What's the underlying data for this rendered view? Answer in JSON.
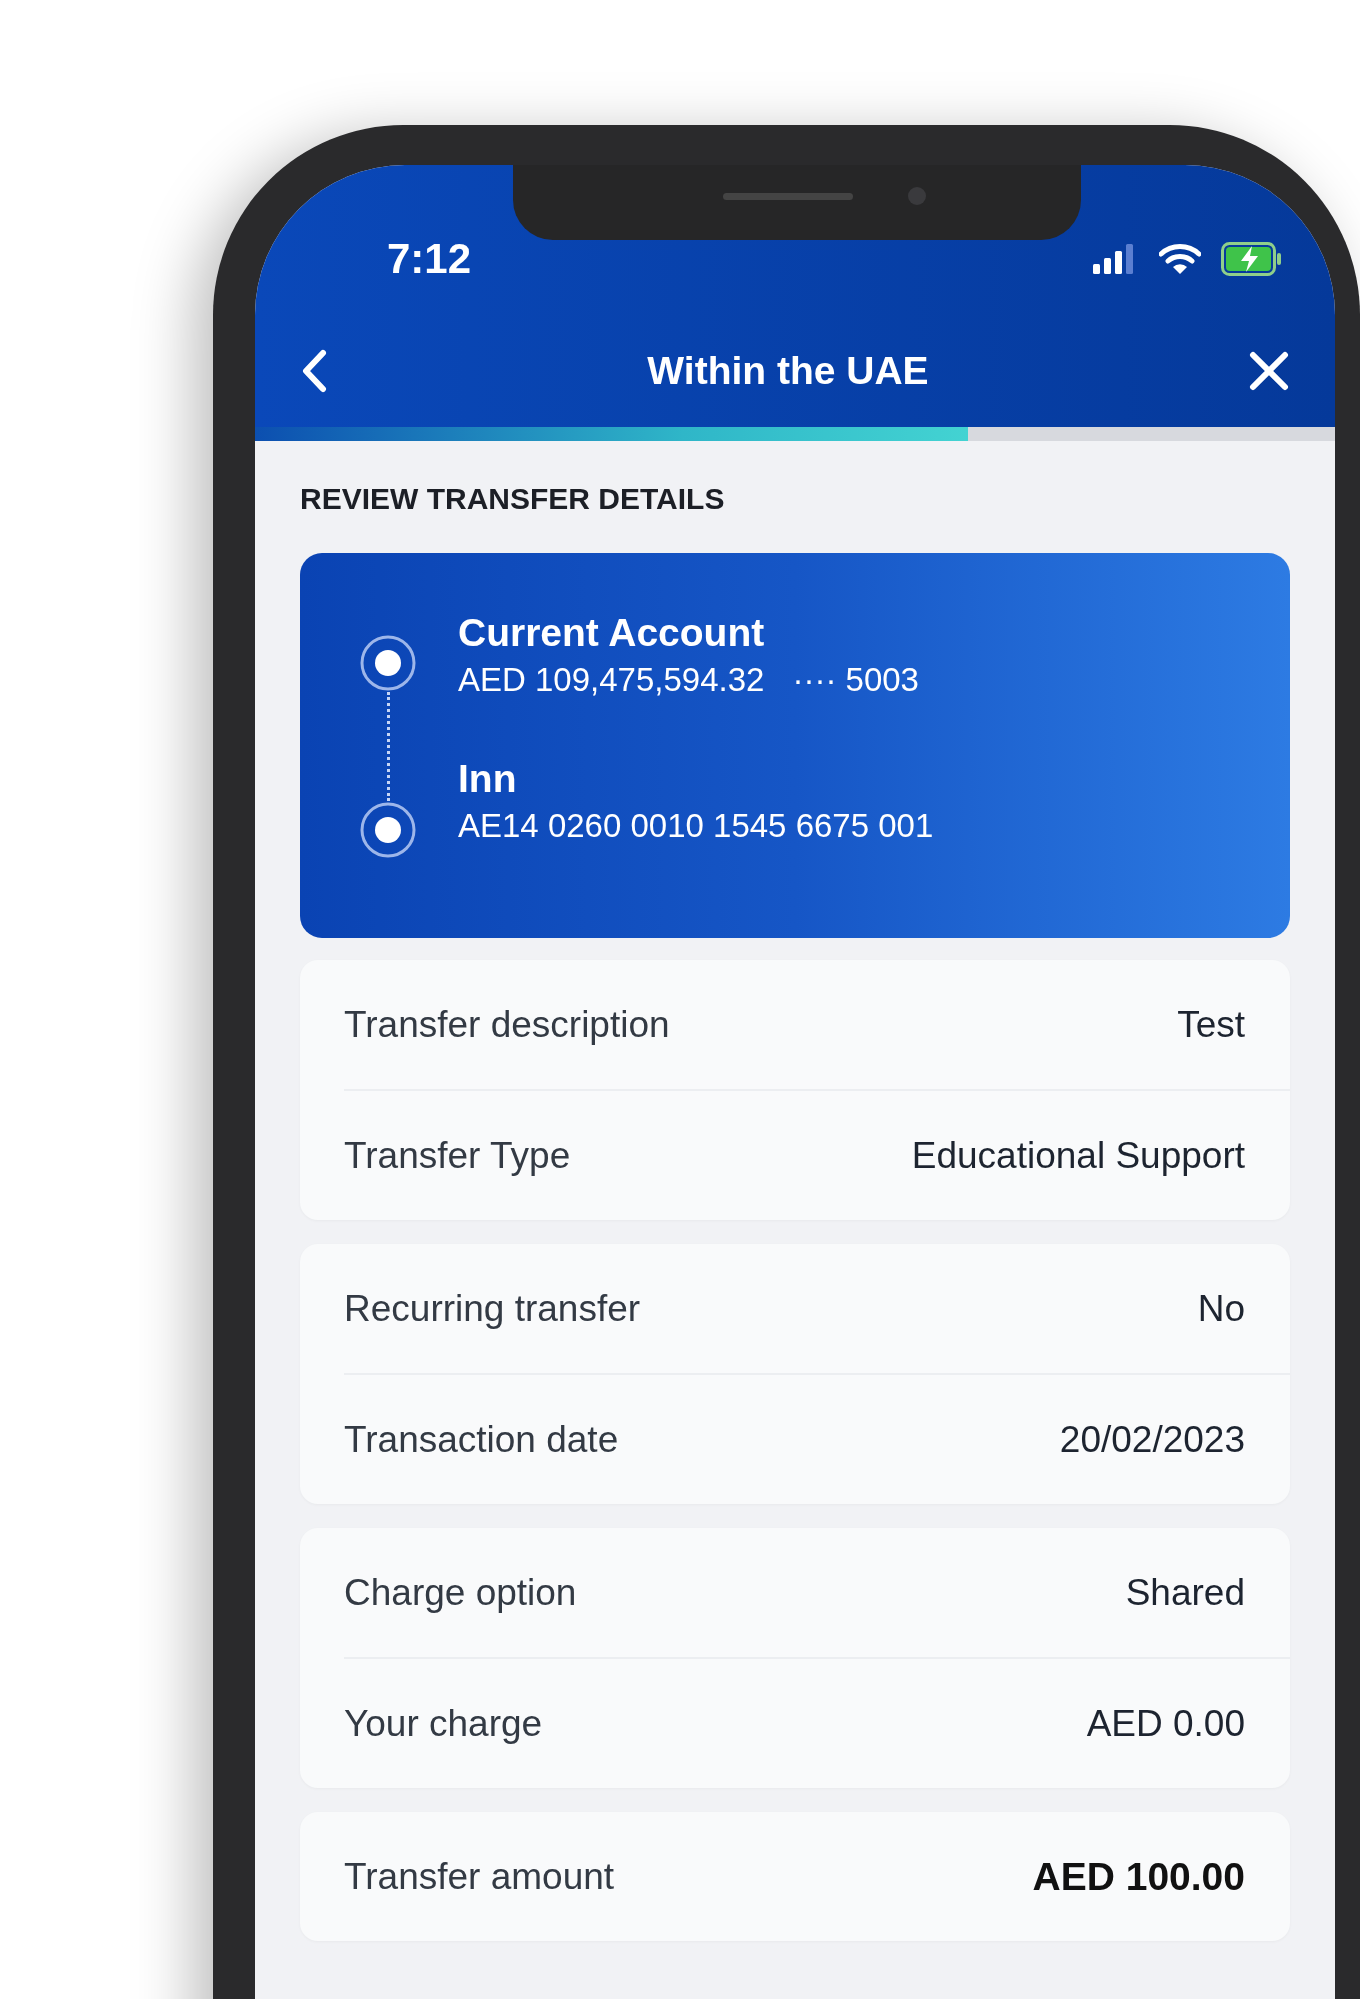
{
  "status_bar": {
    "time": "7:12"
  },
  "header": {
    "title": "Within the UAE"
  },
  "progress": {
    "level": 0.66
  },
  "section_title": "REVIEW TRANSFER DETAILS",
  "transfer_card": {
    "from": {
      "name": "Current Account",
      "balance": "AED 109,475,594.32",
      "account": "···· 5003"
    },
    "to": {
      "name": "Inn",
      "iban": "AE14 0260 0010 1545 6675 001"
    }
  },
  "detail_groups": [
    {
      "rows": [
        {
          "label": "Transfer description",
          "value": "Test",
          "emphasis": false
        },
        {
          "label": "Transfer Type",
          "value": "Educational Support",
          "emphasis": false
        }
      ]
    },
    {
      "rows": [
        {
          "label": "Recurring transfer",
          "value": "No",
          "emphasis": false
        },
        {
          "label": "Transaction date",
          "value": "20/02/2023",
          "emphasis": false
        }
      ]
    },
    {
      "rows": [
        {
          "label": "Charge option",
          "value": "Shared",
          "emphasis": false
        },
        {
          "label": "Your charge",
          "value": "AED 0.00",
          "emphasis": false
        }
      ]
    },
    {
      "rows": [
        {
          "label": "Transfer amount",
          "value": "AED 100.00",
          "emphasis": true
        }
      ]
    }
  ]
}
